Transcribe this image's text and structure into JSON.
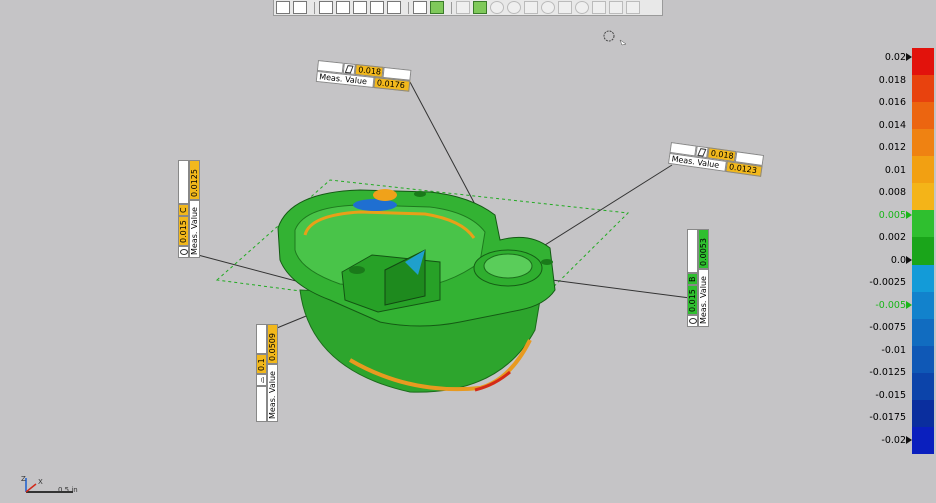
{
  "scale": {
    "colors": [
      "#e2120c",
      "#e8420e",
      "#ec6510",
      "#ef8212",
      "#f2a012",
      "#f4b418",
      "#2fbf2f",
      "#1aa51a",
      "#139bd8",
      "#1282cc",
      "#116cc0",
      "#0f58b6",
      "#0c44aa",
      "#0a2e9e",
      "#0a1fbe"
    ],
    "ticks": [
      {
        "label": "0.02",
        "green": false
      },
      {
        "label": "0.018",
        "green": false
      },
      {
        "label": "0.016",
        "green": false
      },
      {
        "label": "0.014",
        "green": false
      },
      {
        "label": "0.012",
        "green": false
      },
      {
        "label": "0.01",
        "green": false
      },
      {
        "label": "0.008",
        "green": false
      },
      {
        "label": "0.005",
        "green": true
      },
      {
        "label": "0.002",
        "green": false
      },
      {
        "label": "0.0",
        "green": false
      },
      {
        "label": "-0.0025",
        "green": false
      },
      {
        "label": "-0.005",
        "green": true
      },
      {
        "label": "-0.0075",
        "green": false
      },
      {
        "label": "-0.01",
        "green": false
      },
      {
        "label": "-0.0125",
        "green": false
      },
      {
        "label": "-0.015",
        "green": false
      },
      {
        "label": "-0.0175",
        "green": false
      },
      {
        "label": "-0.02",
        "green": false
      }
    ]
  },
  "callouts": {
    "top": {
      "tol": "0.018",
      "meas_label": "Meas. Value",
      "meas": "0.0176"
    },
    "right": {
      "tol": "0.018",
      "meas_label": "Meas. Value",
      "meas": "0.0123"
    },
    "left_c": {
      "tol": "0.015",
      "datum": "C",
      "meas_label": "Meas. Value",
      "meas": "0.0125"
    },
    "right_b": {
      "tol": "0.015",
      "datum": "B",
      "meas_label": "Meas. Value",
      "meas": "0.0053"
    },
    "bottom_left": {
      "tol": "0.1",
      "meas_label": "Meas. Value",
      "meas": "0.0509"
    }
  },
  "axes": {
    "x": "X",
    "z": "Z",
    "unit": "0.5 in"
  },
  "toolbar": {
    "icons": [
      "view-iso-icon",
      "view-front-icon",
      "view-top-icon",
      "view-side-icon",
      "view-back-icon",
      "view-bottom-icon",
      "fit-view-icon",
      "grid-icon",
      "grid-selected-icon",
      "line-icon",
      "select-box-icon",
      "rotate-icon",
      "pan-icon",
      "zoom-icon",
      "measure-icon",
      "clip-icon",
      "light-icon",
      "probe-icon",
      "settings-icon",
      "export-icon"
    ]
  }
}
